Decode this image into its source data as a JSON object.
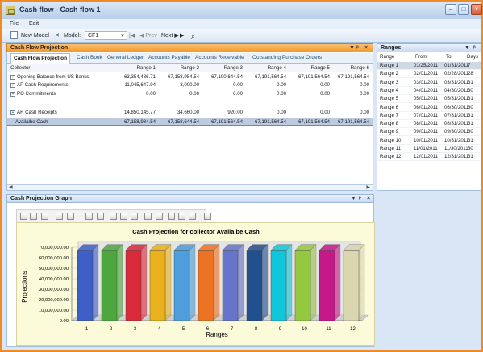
{
  "app": {
    "title": "Cash flow - Cash flow 1"
  },
  "menu": [
    "File",
    "Edit"
  ],
  "toolbar": {
    "new_model": "New Model",
    "model_label": "Model:",
    "model_value": "CF1",
    "prev": "Prev",
    "next": "Next"
  },
  "projection_panel": {
    "title": "Cash Flow Projection",
    "tabs": [
      "Cash Flow Projection",
      "Cash Book",
      "General Ledger",
      "Accounts Payable",
      "Accounts Receivable",
      "Outstanding Purchase Orders"
    ],
    "columns": [
      "Collector",
      "Range 1",
      "Range 2",
      "Range 3",
      "Range 4",
      "Range 5",
      "Range 6"
    ],
    "rows": [
      {
        "label": "Opening Balance from US Banks",
        "values": [
          "63,354,486.71",
          "67,158,984.54",
          "67,190,644.54",
          "67,191,564.54",
          "67,191,564.54",
          "67,191,564.54"
        ],
        "expanded": "+"
      },
      {
        "label": "AP Cash Requirements",
        "values": [
          "-11,045,647.94",
          "-3,000.00",
          "0.00",
          "0.00",
          "0.00",
          "0.00"
        ],
        "expanded": "+"
      },
      {
        "label": "PO Commitments",
        "values": [
          "0.00",
          "0.00",
          "0.00",
          "0.00",
          "0.00",
          "0.00"
        ],
        "expanded": "+"
      },
      {
        "label": "AR Cash Receipts",
        "values": [
          "14,850,145.77",
          "34,660.00",
          "920.00",
          "0.00",
          "0.00",
          "0.00"
        ],
        "expanded": "+"
      },
      {
        "label": "Availalbe Cash",
        "values": [
          "67,158,984.54",
          "67,158,644.54",
          "67,191,564.54",
          "67,191,564.54",
          "67,191,564.54",
          "67,191,564.54"
        ],
        "expanded": ""
      }
    ]
  },
  "ranges_panel": {
    "title": "Ranges",
    "columns": [
      "Range",
      "From",
      "To",
      "Days"
    ],
    "rows": [
      [
        "Range 1",
        "01/25/2011",
        "01/31/2011",
        "7"
      ],
      [
        "Range 2",
        "02/01/2011",
        "02/28/2011",
        "28"
      ],
      [
        "Range 3",
        "03/01/2011",
        "03/31/2011",
        "31"
      ],
      [
        "Range 4",
        "04/01/2011",
        "04/30/2011",
        "30"
      ],
      [
        "Range 5",
        "05/01/2011",
        "05/31/2011",
        "31"
      ],
      [
        "Range 6",
        "06/01/2011",
        "06/30/2011",
        "30"
      ],
      [
        "Range 7",
        "07/01/2011",
        "07/31/2011",
        "31"
      ],
      [
        "Range 8",
        "08/01/2011",
        "08/31/2011",
        "31"
      ],
      [
        "Range 9",
        "09/01/2011",
        "09/30/2011",
        "30"
      ],
      [
        "Range 10",
        "10/01/2011",
        "10/31/2011",
        "31"
      ],
      [
        "Range 11",
        "11/01/2011",
        "11/30/2011",
        "30"
      ],
      [
        "Range 12",
        "12/01/2011",
        "12/31/2011",
        "31"
      ]
    ]
  },
  "graph_panel": {
    "title": "Cash Projection Graph"
  },
  "chart_data": {
    "type": "bar",
    "title": "Cash Projection for collector Availalbe Cash",
    "xlabel": "Ranges",
    "ylabel": "Projections",
    "categories": [
      "1",
      "2",
      "3",
      "4",
      "5",
      "6",
      "7",
      "8",
      "9",
      "10",
      "11",
      "12"
    ],
    "values": [
      67158984.54,
      67158644.54,
      67191564.54,
      67191564.54,
      67191564.54,
      67191564.54,
      67191564.54,
      67191564.54,
      67191564.54,
      67191564.54,
      67191564.54,
      67191564.54
    ],
    "ylim": [
      0,
      70000000
    ],
    "yticks": [
      "0.00",
      "10,000,000.00",
      "20,000,000.00",
      "30,000,000.00",
      "40,000,000.00",
      "50,000,000.00",
      "60,000,000.00",
      "70,000,000.00"
    ],
    "colors": [
      "#3f5fc8",
      "#4ea63f",
      "#d92a3a",
      "#e8b11d",
      "#4d9edb",
      "#ed7324",
      "#6674c9",
      "#21508f",
      "#10c6d8",
      "#94c83f",
      "#c5198a",
      "#d9d6b0"
    ],
    "grid": true,
    "legend": "none"
  },
  "icons": {
    "close": "×",
    "minimize": "–",
    "maximize": "□",
    "search": "⌕"
  }
}
